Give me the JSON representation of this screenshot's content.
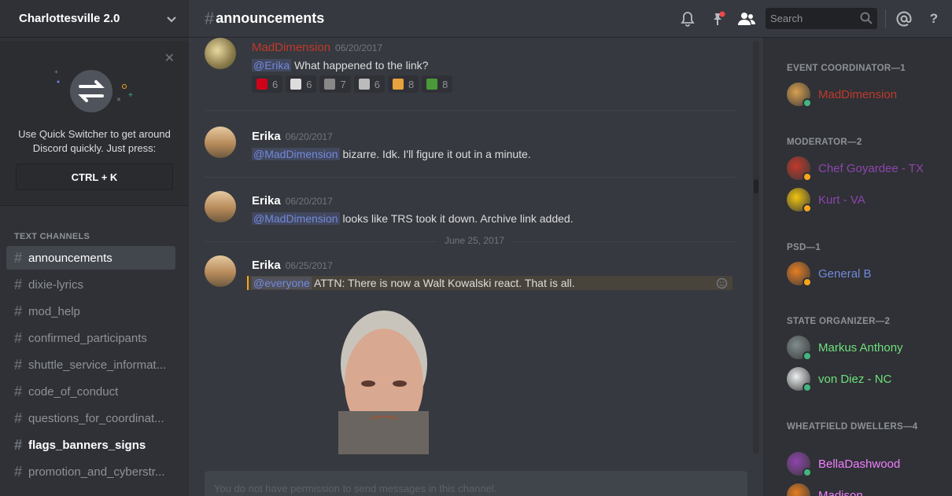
{
  "server": {
    "name": "Charlottesville 2.0"
  },
  "quick_switcher": {
    "text": "Use Quick Switcher to get around Discord quickly. Just press:",
    "shortcut": "CTRL + K"
  },
  "channels": {
    "category": "TEXT CHANNELS",
    "items": [
      {
        "name": "announcements",
        "state": "active"
      },
      {
        "name": "dixie-lyrics",
        "state": "normal"
      },
      {
        "name": "mod_help",
        "state": "normal"
      },
      {
        "name": "confirmed_participants",
        "state": "normal"
      },
      {
        "name": "shuttle_service_informat...",
        "state": "normal"
      },
      {
        "name": "code_of_conduct",
        "state": "normal"
      },
      {
        "name": "questions_for_coordinat...",
        "state": "normal"
      },
      {
        "name": "flags_banners_signs",
        "state": "unread"
      },
      {
        "name": "promotion_and_cyberstr...",
        "state": "normal"
      }
    ]
  },
  "header": {
    "hash": "#",
    "channel": "announcements",
    "search_placeholder": "Search",
    "icons": [
      "bell-icon",
      "pin-icon",
      "members-icon",
      "search-icon",
      "mention-icon",
      "help-icon"
    ]
  },
  "messages": [
    {
      "author": "MadDimension",
      "author_color": "#c0392b",
      "timestamp": "06/20/2017",
      "mention": "@Erika",
      "text": "What happened to the link?",
      "reactions": [
        {
          "emoji": "hammer-sickle",
          "count": "6"
        },
        {
          "emoji": "skull",
          "count": "6"
        },
        {
          "emoji": "face",
          "count": "7"
        },
        {
          "emoji": "keyboard",
          "count": "6"
        },
        {
          "emoji": "sun-wheel",
          "count": "8"
        },
        {
          "emoji": "frog",
          "count": "8"
        }
      ]
    },
    {
      "author": "Erika",
      "timestamp": "06/20/2017",
      "mention": "@MadDimension",
      "text": "bizarre. Idk. I'll figure it out in a minute."
    },
    {
      "author": "Erika",
      "timestamp": "06/20/2017",
      "mention": "@MadDimension",
      "text": "looks like TRS took it down. Archive link added."
    },
    {
      "author": "Erika",
      "timestamp": "06/25/2017",
      "mention": "@everyone",
      "text": "ATTN: There is now a Walt Kowalski react. That is all."
    }
  ],
  "date_divider": "June 25, 2017",
  "composer": {
    "placeholder": "You do not have permission to send messages in this channel."
  },
  "members": {
    "roles": [
      {
        "title": "EVENT COORDINATOR—1",
        "members": [
          {
            "name": "MadDimension",
            "color": "#c0392b",
            "status": "#43b581"
          }
        ]
      },
      {
        "title": "MODERATOR—2",
        "members": [
          {
            "name": "Chef Goyardee - TX",
            "color": "#8e44ad",
            "status": "#faa61a"
          },
          {
            "name": "Kurt - VA",
            "color": "#8e44ad",
            "status": "#faa61a"
          }
        ]
      },
      {
        "title": "PSD—1",
        "members": [
          {
            "name": "General B",
            "color": "#7289da",
            "status": "#faa61a"
          }
        ]
      },
      {
        "title": "STATE ORGANIZER—2",
        "members": [
          {
            "name": "Markus Anthony",
            "color": "#6ee07b",
            "status": "#43b581"
          },
          {
            "name": "von Diez - NC",
            "color": "#6ee07b",
            "status": "#43b581"
          }
        ]
      },
      {
        "title": "WHEATFIELD DWELLERS—4",
        "members": [
          {
            "name": "BellaDashwood",
            "color": "#f47fff",
            "status": "#43b581"
          },
          {
            "name": "Madison",
            "color": "#f47fff",
            "status": "#43b581"
          }
        ]
      }
    ]
  }
}
